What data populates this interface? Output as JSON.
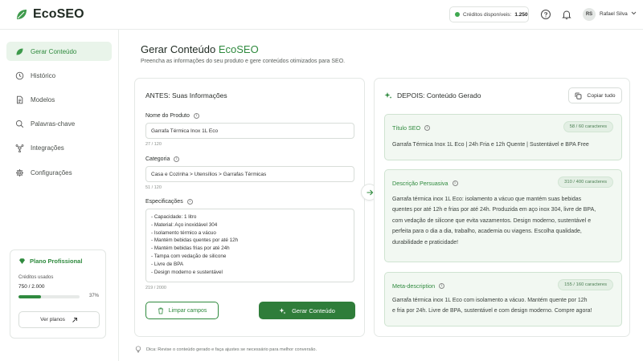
{
  "header": {
    "app_name": "EcoSEO",
    "credits_label": "Créditos disponíveis:",
    "credits_value": "1.250",
    "user_initials": "RS",
    "user_name": "Rafael Silva"
  },
  "sidebar": {
    "items": [
      {
        "label": "Gerar Conteúdo",
        "icon": "leaf-icon",
        "active": true
      },
      {
        "label": "Histórico",
        "icon": "clock-icon",
        "active": false
      },
      {
        "label": "Modelos",
        "icon": "document-icon",
        "active": false
      },
      {
        "label": "Palavras-chave",
        "icon": "search-icon",
        "active": false
      },
      {
        "label": "Integrações",
        "icon": "integrations-icon",
        "active": false
      },
      {
        "label": "Configurações",
        "icon": "gear-icon",
        "active": false
      }
    ],
    "plan": {
      "title": "Plano Profissional",
      "usage_label": "Créditos usados",
      "usage_value": "750 / 2.000",
      "usage_percent_text": "37%",
      "usage_fraction": 0.37,
      "button_label": "Ver planos"
    }
  },
  "main": {
    "title_prefix": "Gerar Conteúdo",
    "title_brand": "EcoSEO",
    "subtitle": "Preencha as informações do seu produto e gere conteúdos otimizados para SEO."
  },
  "before": {
    "title": "ANTES: Suas Informações",
    "product_label": "Nome do Produto",
    "product_value": "Garrafa Térmica Inox 1L Eco",
    "product_counter": "27 / 120",
    "category_label": "Categoria",
    "category_value": "Casa e Cozinha > Utensílios > Garrafas Térmicas",
    "category_counter": "51 / 120",
    "specs_label": "Especificações",
    "specs_lines": [
      "- Capacidade: 1 litro",
      "- Material: Aço inoxidável 304",
      "- Isolamento térmico a vácuo",
      "- Mantém bebidas quentes por até 12h",
      "- Mantém bebidas frias por até 24h",
      "- Tampa com vedação de silicone",
      "- Livre de BPA",
      "- Design moderno e sustentável"
    ],
    "specs_counter": "219 / 2000",
    "clear_button": "Limpar campos",
    "generate_button": "Gerar Conteúdo"
  },
  "after": {
    "title": "DEPOIS: Conteúdo Gerado",
    "copy_button": "Copiar tudo",
    "seo_title_label": "Título SEO",
    "seo_title_badge": "58 / 60 caracteres",
    "seo_title_text": "Garrafa Térmica Inox 1L Eco | 24h Fria e 12h Quente | Sustentável e BPA Free",
    "description_label": "Descrição Persuasiva",
    "description_badge": "310 / 400 caracteres",
    "description_lines": [
      "Garrafa térmica inox 1L Eco: isolamento a vácuo que mantém suas bebidas",
      "quentes por até 12h e frias por até 24h. Produzida em aço inox 304, livre de BPA,",
      "com vedação de silicone que evita vazamentos. Design moderno, sustentável e",
      "perfeita para o dia a dia, trabalho, academia ou viagens. Escolha qualidade,",
      "durabilidade e praticidade!"
    ],
    "meta_label": "Meta-description",
    "meta_badge": "155 / 160 caracteres",
    "meta_lines": [
      "Garrafa térmica inox 1L Eco com isolamento a vácuo. Mantém quente por 12h",
      "e fria por 24h. Livre de BPA, sustentável e com design moderno. Compre agora!"
    ]
  },
  "footer": {
    "tip": "Dica: Revise o conteúdo gerado e faça ajustes se necessário para melhor conversão."
  },
  "colors": {
    "brand_green": "#2f8a3e",
    "primary_button": "#2f7d3a",
    "active_nav_bg": "#e9f4ea",
    "output_card_bg": "#f2f8f2"
  }
}
